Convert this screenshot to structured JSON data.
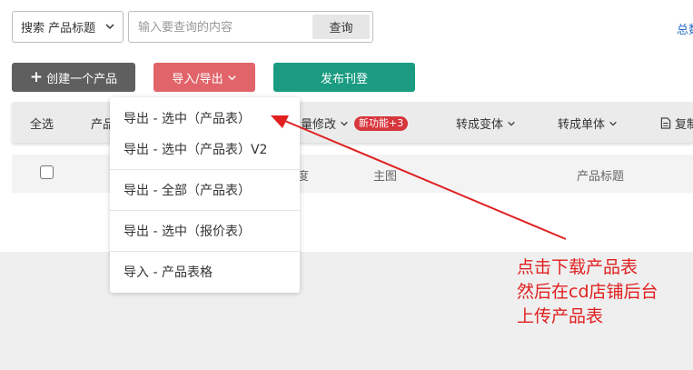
{
  "search": {
    "field_select": "搜索 产品标题",
    "placeholder": "输入要查询的内容",
    "query_button": "查询",
    "total_link": "总数"
  },
  "actions": {
    "create": "创建一个产品",
    "import_export": "导入/导出",
    "publish": "发布刊登"
  },
  "toolbar": {
    "select_all": "全选",
    "product": "产品",
    "bulk_edit": "批量修改",
    "new_feature_badge": "新功能+3",
    "to_variant": "转成变体",
    "to_single": "转成单体",
    "copy": "复制"
  },
  "table_header": {
    "degree": "度",
    "main_image": "主图",
    "product_title": "产品标题"
  },
  "dropdown": {
    "items": [
      "导出 - 选中（产品表）",
      "导出 - 选中（产品表）V2",
      "导出 - 全部（产品表）",
      "导出 - 选中（报价表）",
      "导入 - 产品表格"
    ]
  },
  "annotation": {
    "lines": [
      "点击下载产品表",
      "然后在cd店铺后台",
      "上传产品表"
    ],
    "color": "#e02020"
  },
  "colors": {
    "create_button": "#5f5f5f",
    "import_export_button": "#e0646a",
    "publish_button": "#1a9b82",
    "badge": "#d7363c"
  }
}
